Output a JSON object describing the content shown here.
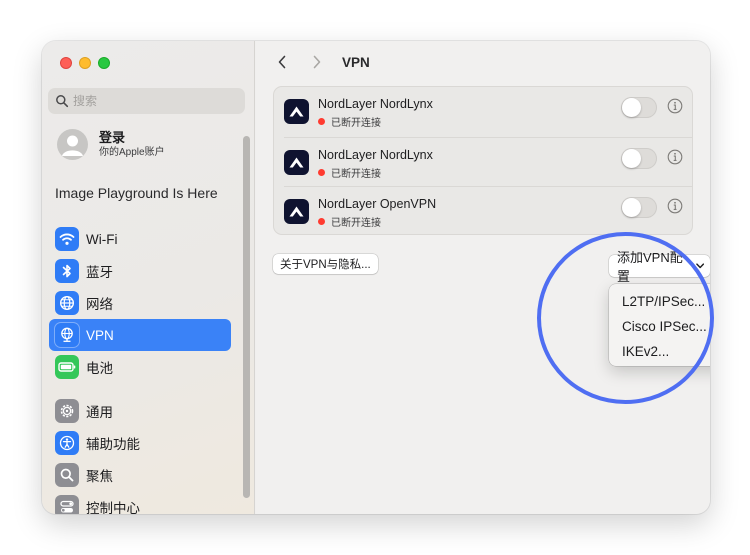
{
  "window": {
    "traffic_lights": [
      "close",
      "minimize",
      "maximize"
    ]
  },
  "sidebar": {
    "search_placeholder": "搜索",
    "account": {
      "name": "登录",
      "subtitle": "你的Apple账户"
    },
    "promo": "Image Playground Is Here",
    "items": [
      {
        "label": "Wi-Fi",
        "icon": "wifi-icon",
        "color": "#2f7cf6"
      },
      {
        "label": "蓝牙",
        "icon": "bluetooth-icon",
        "color": "#2f7cf6"
      },
      {
        "label": "网络",
        "icon": "globe-icon",
        "color": "#2f7cf6"
      },
      {
        "label": "VPN",
        "icon": "vpn-globe-icon",
        "color": "#2f7cf6",
        "active": true
      },
      {
        "label": "电池",
        "icon": "battery-icon",
        "color": "#34c759"
      },
      {
        "label": "通用",
        "icon": "gear-icon",
        "color": "#8e8e93"
      },
      {
        "label": "辅助功能",
        "icon": "accessibility-icon",
        "color": "#2f7cf6"
      },
      {
        "label": "聚焦",
        "icon": "magnifier-icon",
        "color": "#8e8e93"
      },
      {
        "label": "控制中心",
        "icon": "control-center-icon",
        "color": "#8e8e93"
      }
    ],
    "accent_color": "#3a82f7"
  },
  "main": {
    "title": "VPN",
    "vpns": [
      {
        "name": "NordLayer NordLynx",
        "status": "已断开连接",
        "enabled": false
      },
      {
        "name": "NordLayer NordLynx",
        "status": "已断开连接",
        "enabled": false
      },
      {
        "name": "NordLayer OpenVPN",
        "status": "已断开连接",
        "enabled": false
      }
    ],
    "status_color": "#ff3b30",
    "about_button": "关于VPN与隐私...",
    "add_button": "添加VPN配置",
    "menu": [
      "L2TP/IPSec...",
      "Cisco IPSec...",
      "IKEv2..."
    ],
    "highlight_color": "#4f6ef2"
  }
}
